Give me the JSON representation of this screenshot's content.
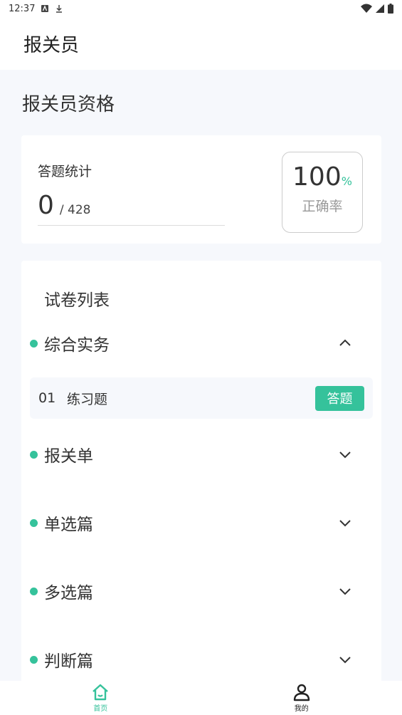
{
  "status_bar": {
    "time": "12:37"
  },
  "app_bar": {
    "title": "报关员"
  },
  "section": {
    "title": "报关员资格"
  },
  "stats": {
    "label": "答题统计",
    "answered": "0",
    "total": "/ 428",
    "rate_value": "100",
    "rate_unit": "%",
    "rate_label": "正确率"
  },
  "paper_list": {
    "title": "试卷列表",
    "categories": [
      {
        "label": "综合实务",
        "expanded": true
      },
      {
        "label": "报关单",
        "expanded": false
      },
      {
        "label": "单选篇",
        "expanded": false
      },
      {
        "label": "多选篇",
        "expanded": false
      },
      {
        "label": "判断篇",
        "expanded": false
      }
    ],
    "items": [
      {
        "num": "01",
        "name": "练习题",
        "button": "答题"
      }
    ]
  },
  "bottom_nav": {
    "items": [
      {
        "label": "首页",
        "icon": "home-icon",
        "active": true
      },
      {
        "label": "我的",
        "icon": "user-icon",
        "active": false
      }
    ]
  },
  "colors": {
    "accent": "#35c29b"
  }
}
